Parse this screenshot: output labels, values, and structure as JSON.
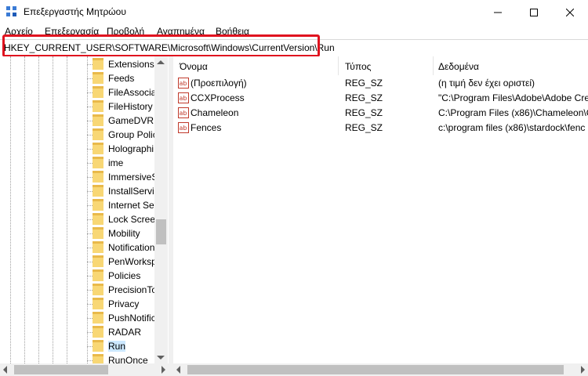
{
  "window": {
    "title": "Επεξεργαστής Μητρώου"
  },
  "menu": {
    "items": [
      "Αρχείο",
      "Επεξεργασία",
      "Προβολή",
      "Αγαπημένα",
      "Βοήθεια"
    ]
  },
  "address": {
    "path": "HKEY_CURRENT_USER\\SOFTWARE\\Microsoft\\Windows\\CurrentVersion\\Run"
  },
  "tree": {
    "items": [
      "Extensions",
      "Feeds",
      "FileAssocia",
      "FileHistory",
      "GameDVR",
      "Group Polic",
      "Holographi",
      "ime",
      "ImmersiveS",
      "InstallServic",
      "Internet Set",
      "Lock Screen",
      "Mobility",
      "Notification",
      "PenWorksp",
      "Policies",
      "PrecisionTo",
      "Privacy",
      "PushNotific",
      "RADAR",
      "Run",
      "RunOnce"
    ],
    "selected": "Run"
  },
  "list": {
    "columns": [
      "Όνομα",
      "Τύπος",
      "Δεδομένα"
    ],
    "rows": [
      {
        "name": "(Προεπιλογή)",
        "type": "REG_SZ",
        "data": "(η τιμή δεν έχει οριστεί)"
      },
      {
        "name": "CCXProcess",
        "type": "REG_SZ",
        "data": "\"C:\\Program Files\\Adobe\\Adobe Cre"
      },
      {
        "name": "Chameleon",
        "type": "REG_SZ",
        "data": "C:\\Program Files (x86)\\Chameleon\\C"
      },
      {
        "name": "Fences",
        "type": "REG_SZ",
        "data": "c:\\program files (x86)\\stardock\\fenc"
      }
    ]
  },
  "colors": {
    "highlight": "#e0131f",
    "selected": "#cce8ff",
    "folder": "#f8d775"
  }
}
